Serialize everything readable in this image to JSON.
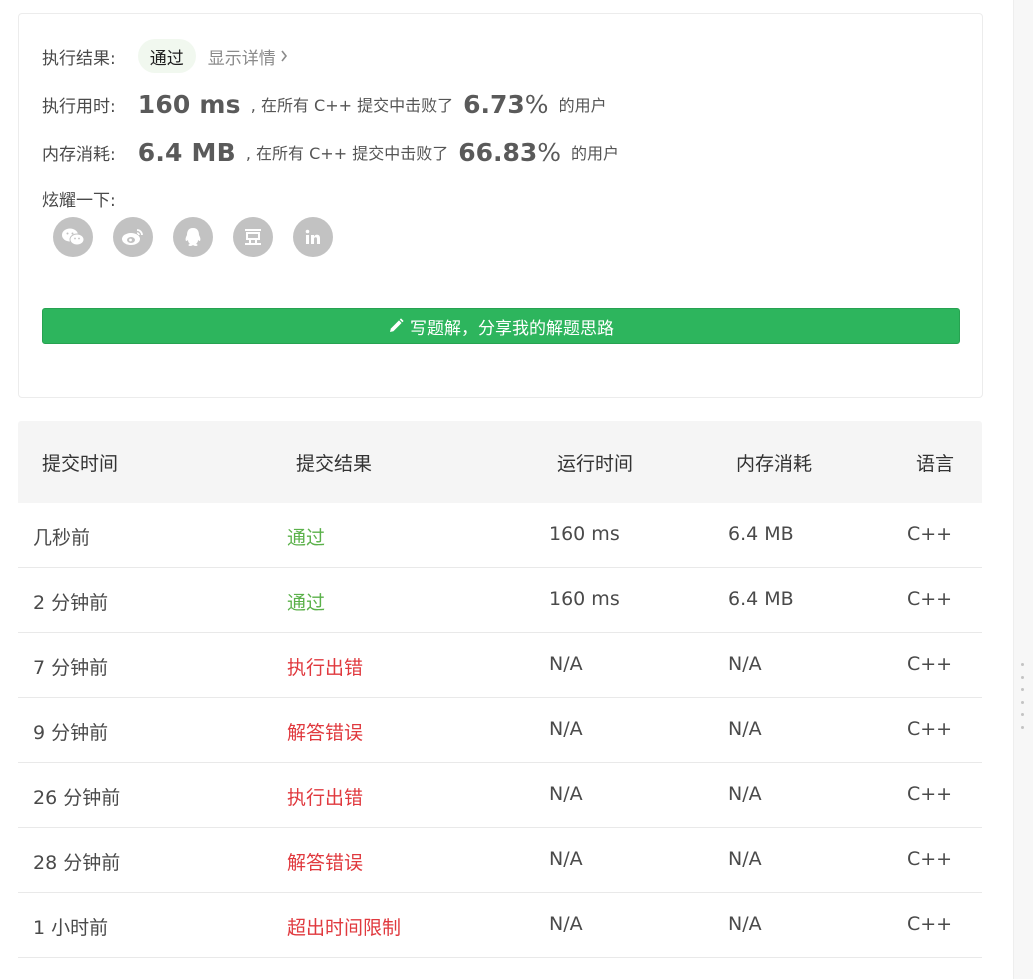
{
  "result": {
    "status_label": "执行结果:",
    "status": "通过",
    "detail_link": "显示详情",
    "runtime_label": "执行用时:",
    "runtime_value": "160 ms",
    "runtime_text": ", 在所有 C++ 提交中击败了",
    "runtime_pct": "6.73",
    "runtime_tail": "的用户",
    "memory_label": "内存消耗:",
    "memory_value": "6.4 MB",
    "memory_text": ", 在所有 C++ 提交中击败了",
    "memory_pct": "66.83",
    "memory_tail": "的用户",
    "pct_sign": "%",
    "share_label": "炫耀一下:",
    "share_icons": [
      "wechat-icon",
      "weibo-icon",
      "qq-icon",
      "douban-icon",
      "linkedin-icon"
    ],
    "write_button": "写题解，分享我的解题思路"
  },
  "table": {
    "headers": [
      "提交时间",
      "提交结果",
      "运行时间",
      "内存消耗",
      "语言"
    ],
    "rows": [
      {
        "time": "几秒前",
        "result": "通过",
        "status": "ok",
        "runtime": "160 ms",
        "memory": "6.4 MB",
        "lang": "C++"
      },
      {
        "time": "2 分钟前",
        "result": "通过",
        "status": "ok",
        "runtime": "160 ms",
        "memory": "6.4 MB",
        "lang": "C++"
      },
      {
        "time": "7 分钟前",
        "result": "执行出错",
        "status": "err",
        "runtime": "N/A",
        "memory": "N/A",
        "lang": "C++"
      },
      {
        "time": "9 分钟前",
        "result": "解答错误",
        "status": "err",
        "runtime": "N/A",
        "memory": "N/A",
        "lang": "C++"
      },
      {
        "time": "26 分钟前",
        "result": "执行出错",
        "status": "err",
        "runtime": "N/A",
        "memory": "N/A",
        "lang": "C++"
      },
      {
        "time": "28 分钟前",
        "result": "解答错误",
        "status": "err",
        "runtime": "N/A",
        "memory": "N/A",
        "lang": "C++"
      },
      {
        "time": "1 小时前",
        "result": "超出时间限制",
        "status": "err",
        "runtime": "N/A",
        "memory": "N/A",
        "lang": "C++"
      }
    ]
  },
  "colors": {
    "accept": "#5bb14a",
    "error": "#e0393e",
    "button": "#2db55d"
  }
}
